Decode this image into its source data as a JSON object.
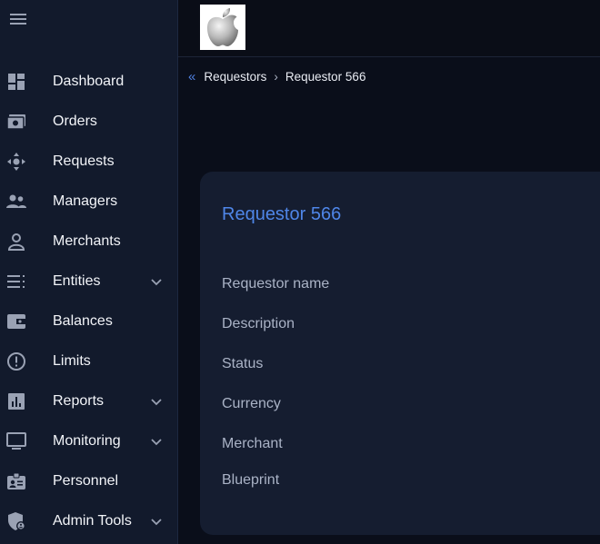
{
  "sidebar": {
    "items": [
      {
        "label": "Dashboard",
        "icon": "dashboard-icon"
      },
      {
        "label": "Orders",
        "icon": "orders-icon"
      },
      {
        "label": "Requests",
        "icon": "requests-icon"
      },
      {
        "label": "Managers",
        "icon": "managers-icon"
      },
      {
        "label": "Merchants",
        "icon": "merchant-icon"
      },
      {
        "label": "Entities",
        "icon": "entities-icon",
        "expandable": true
      },
      {
        "label": "Balances",
        "icon": "wallet-icon"
      },
      {
        "label": "Limits",
        "icon": "limits-icon"
      },
      {
        "label": "Reports",
        "icon": "reports-icon",
        "expandable": true
      },
      {
        "label": "Monitoring",
        "icon": "monitor-icon",
        "expandable": true
      },
      {
        "label": "Personnel",
        "icon": "personnel-icon"
      },
      {
        "label": "Admin Tools",
        "icon": "admin-shield-icon",
        "expandable": true
      }
    ]
  },
  "header": {
    "logo": "apple-logo-icon"
  },
  "breadcrumb": {
    "parent": "Requestors",
    "separator": "›",
    "current": "Requestor 566"
  },
  "card": {
    "title": "Requestor 566",
    "fields": [
      {
        "label": "Requestor name"
      },
      {
        "label": "Description"
      },
      {
        "label": "Status"
      },
      {
        "label": "Currency"
      },
      {
        "label": "Merchant"
      },
      {
        "label": "Blueprint"
      }
    ]
  },
  "colors": {
    "accent": "#4f86e8",
    "sidebar_bg": "#121a2c",
    "page_bg": "#0a0e1a",
    "card_bg": "#151d30",
    "icon_gray": "#9aa2b4"
  }
}
